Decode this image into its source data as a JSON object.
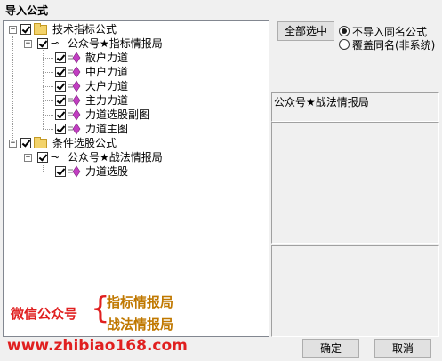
{
  "window": {
    "title": "导入公式"
  },
  "tree": {
    "groups": [
      {
        "label": "技术指标公式",
        "children": [
          {
            "label": "公众号★指标情报局",
            "children": [
              {
                "label": "散户力道"
              },
              {
                "label": "中户力道"
              },
              {
                "label": "大户力道"
              },
              {
                "label": "主力力道"
              },
              {
                "label": "力道选股副图"
              },
              {
                "label": "力道主图"
              }
            ]
          }
        ]
      },
      {
        "label": "条件选股公式",
        "children": [
          {
            "label": "公众号★战法情报局",
            "children": [
              {
                "label": "力道选股"
              }
            ]
          }
        ]
      }
    ]
  },
  "right": {
    "select_all_label": "全部选中",
    "options": [
      {
        "label": "不导入同名公式",
        "selected": true
      },
      {
        "label": "覆盖同名(非系统)",
        "selected": false
      }
    ],
    "info_text": "公众号★战法情报局"
  },
  "watermark": {
    "prefix": "微信公众号",
    "line1": "指标情报局",
    "line2": "战法情报局",
    "url": "www.zhibiao168.com"
  },
  "buttons": {
    "ok": "确定",
    "cancel": "取消"
  },
  "colors": {
    "watermark_red": "#e02020",
    "watermark_orange": "#c07800"
  }
}
